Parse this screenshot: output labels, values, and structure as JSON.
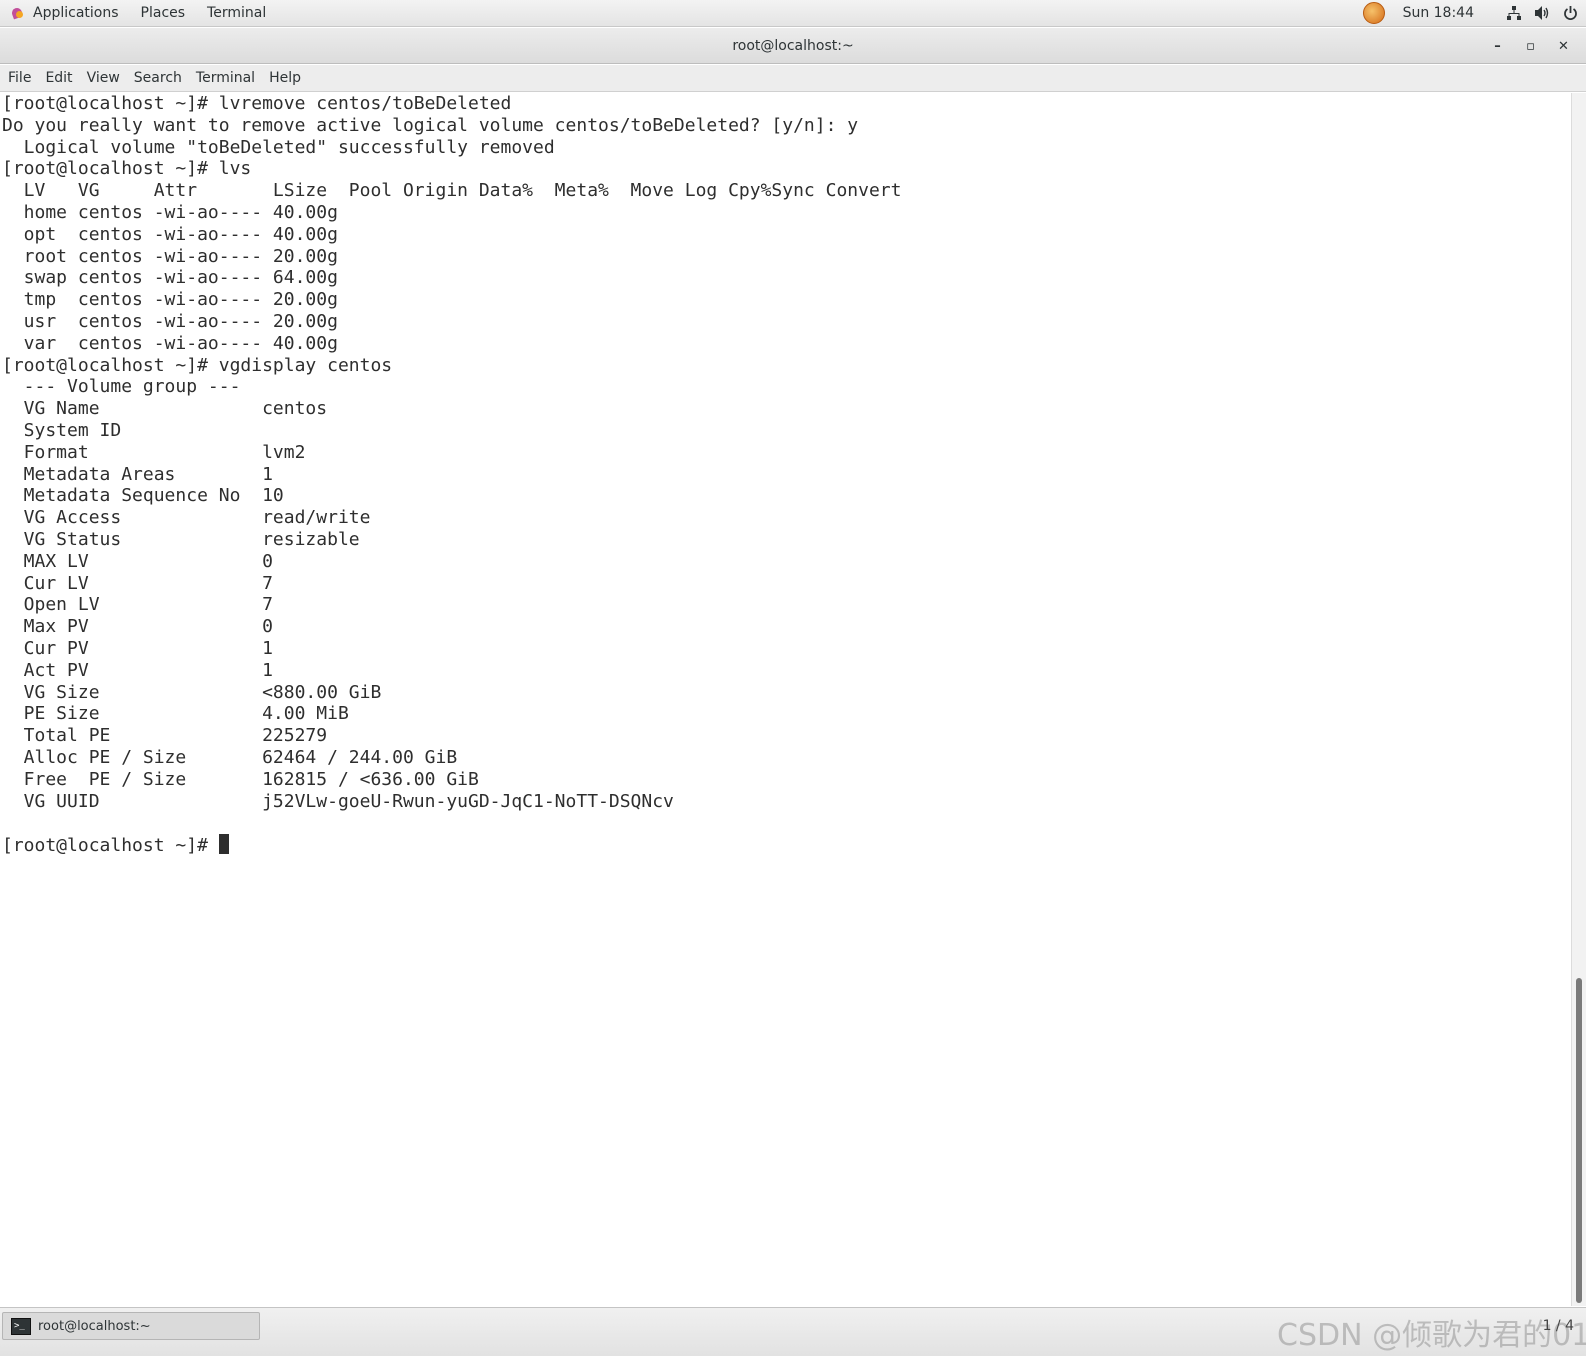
{
  "top_panel": {
    "applications": "Applications",
    "places": "Places",
    "terminal": "Terminal",
    "clock": "Sun 18:44"
  },
  "window": {
    "title": "root@localhost:~",
    "minimize": "–",
    "maximize": "▫",
    "close": "✕"
  },
  "menubar": [
    "File",
    "Edit",
    "View",
    "Search",
    "Terminal",
    "Help"
  ],
  "terminal": {
    "lines": [
      "[root@localhost ~]# lvremove centos/toBeDeleted",
      "Do you really want to remove active logical volume centos/toBeDeleted? [y/n]: y",
      "  Logical volume \"toBeDeleted\" successfully removed",
      "[root@localhost ~]# lvs",
      "  LV   VG     Attr       LSize  Pool Origin Data%  Meta%  Move Log Cpy%Sync Convert",
      "  home centos -wi-ao---- 40.00g",
      "  opt  centos -wi-ao---- 40.00g",
      "  root centos -wi-ao---- 20.00g",
      "  swap centos -wi-ao---- 64.00g",
      "  tmp  centos -wi-ao---- 20.00g",
      "  usr  centos -wi-ao---- 20.00g",
      "  var  centos -wi-ao---- 40.00g",
      "[root@localhost ~]# vgdisplay centos",
      "  --- Volume group ---",
      "  VG Name               centos",
      "  System ID",
      "  Format                lvm2",
      "  Metadata Areas        1",
      "  Metadata Sequence No  10",
      "  VG Access             read/write",
      "  VG Status             resizable",
      "  MAX LV                0",
      "  Cur LV                7",
      "  Open LV               7",
      "  Max PV                0",
      "  Cur PV                1",
      "  Act PV                1",
      "  VG Size               <880.00 GiB",
      "  PE Size               4.00 MiB",
      "  Total PE              225279",
      "  Alloc PE / Size       62464 / 244.00 GiB",
      "  Free  PE / Size       162815 / <636.00 GiB",
      "  VG UUID               j52VLw-goeU-Rwun-yuGD-JqC1-NoTT-DSQNcv",
      ""
    ],
    "prompt": "[root@localhost ~]# "
  },
  "taskbar": {
    "task_label": "root@localhost:~",
    "task_icon": ">_",
    "watermark": "CSDN @倾歌为君的01",
    "workspace": "1 / 4"
  }
}
